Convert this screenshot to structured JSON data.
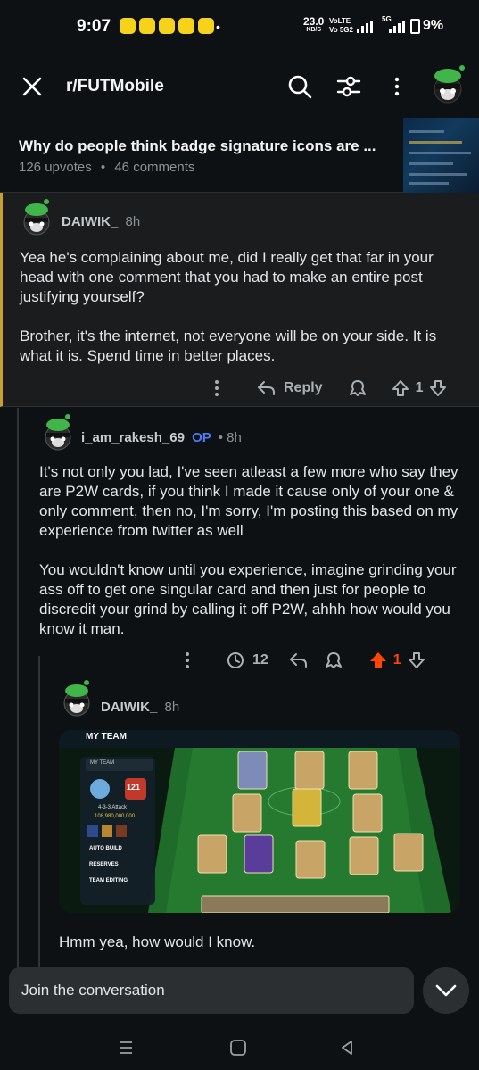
{
  "status_bar": {
    "time": "9:07",
    "speed_value": "23.0",
    "speed_unit": "KB/S",
    "volte": "VoLTE",
    "volte2": "Vo 5G2",
    "network": "5G",
    "battery": "9%"
  },
  "header": {
    "subreddit": "r/FUTMobile",
    "icons": [
      "close-icon",
      "search-icon",
      "filter-icon",
      "more-vertical-icon",
      "avatar"
    ]
  },
  "post": {
    "title": "Why do people think badge signature icons are ...",
    "upvotes": "126 upvotes",
    "separator": "•",
    "comments": "46 comments"
  },
  "comments": [
    {
      "author": "DAIWIK_",
      "age": "8h",
      "paragraphs": [
        "Yea he's complaining about me, did I really get that far in your head with one comment that you had to make an entire post justifying yourself?",
        "Brother, it's the internet, not everyone will be on your side. It is what it is. Spend time in better places."
      ],
      "reply_label": "Reply",
      "votes": "1"
    },
    {
      "author": "i_am_rakesh_69",
      "op_badge": "OP",
      "age": "• 8h",
      "paragraphs": [
        "It's not only you lad, I've seen atleast a few more who say they are P2W cards, if you think I made it cause only of your one & only comment, then no, I'm sorry, I'm posting this based on my experience from twitter as well",
        "You wouldn't know until you experience, imagine grinding your ass off to get one singular card and then just for people to discredit your grind by calling it off P2W, ahhh how would you know it man."
      ],
      "award_count": "12",
      "votes": "1"
    },
    {
      "author": "DAIWIK_",
      "age": "8h",
      "text": "Hmm yea, how would I know."
    }
  ],
  "game_screenshot": {
    "header": "MY TEAM",
    "dropdown": "MY TEAM",
    "rating": "121",
    "formation": "4-3-3 Attack",
    "coins": "108,980,000,000",
    "menu": [
      "AUTO BUILD",
      "RESERVES",
      "TEAM EDITING"
    ]
  },
  "composer": {
    "placeholder": "Join the conversation"
  },
  "colors": {
    "background": "#0e1113",
    "highlight_border": "#c79f32",
    "upvote_active": "#ff4500",
    "op_blue": "#4d7cf5"
  }
}
